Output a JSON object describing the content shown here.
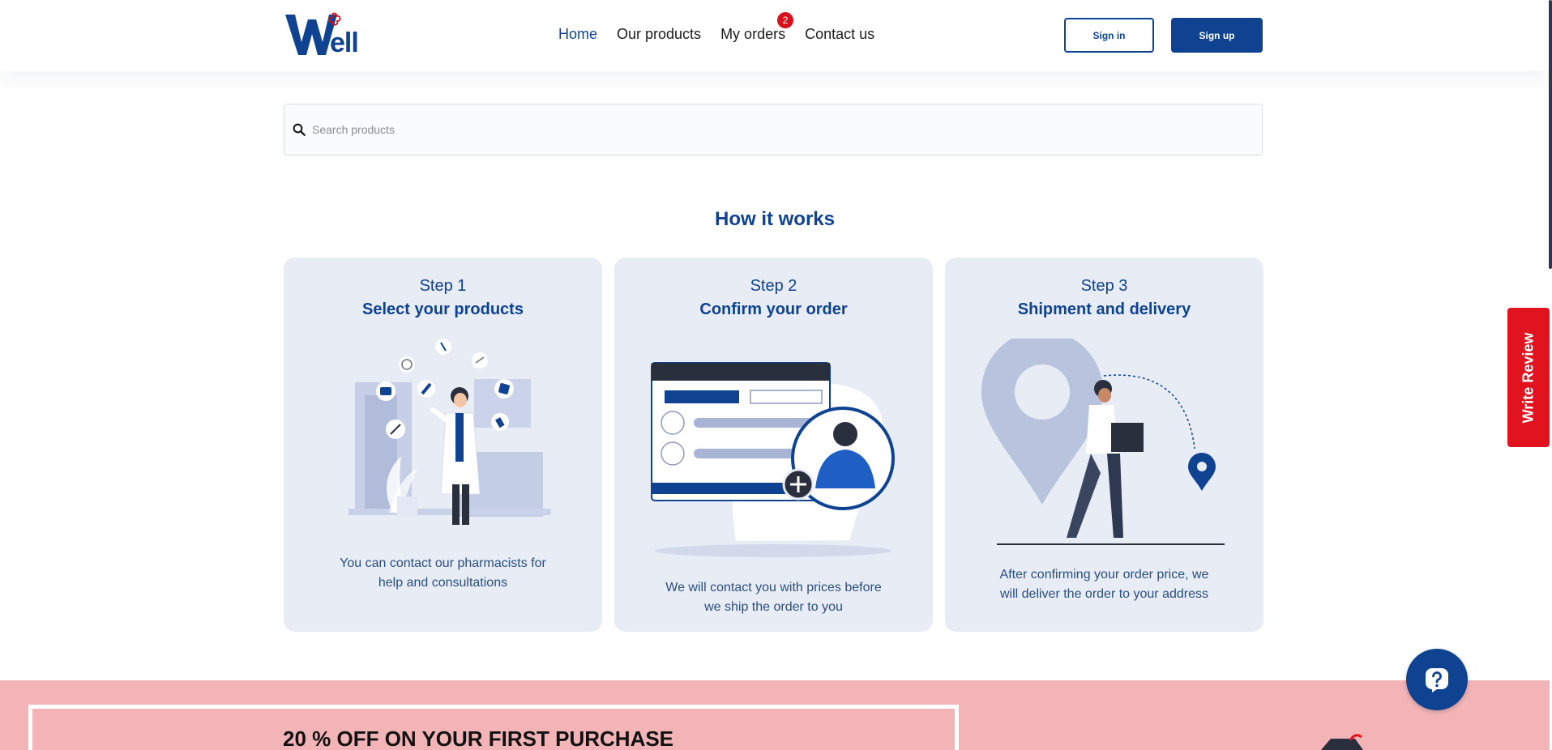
{
  "header": {
    "logo_text": "Well",
    "nav": [
      {
        "label": "Home",
        "active": true
      },
      {
        "label": "Our products",
        "active": false
      },
      {
        "label": "My orders",
        "active": false,
        "badge": "2"
      },
      {
        "label": "Contact us",
        "active": false
      }
    ],
    "signin_label": "Sign in",
    "signup_label": "Sign up"
  },
  "search": {
    "placeholder": "Search products"
  },
  "how_it_works": {
    "title": "How it works",
    "steps": [
      {
        "step": "Step 1",
        "title": "Select your products",
        "desc": "You can contact our pharmacists for help and consultations"
      },
      {
        "step": "Step 2",
        "title": "Confirm your order",
        "desc": "We will contact you with prices before we ship the order to you"
      },
      {
        "step": "Step 3",
        "title": "Shipment and delivery",
        "desc": "After confirming your order price, we will deliver the order to your address"
      }
    ]
  },
  "write_review_label": "Write Review",
  "promo": {
    "text": "20 % OFF ON YOUR FIRST PURCHASE"
  },
  "colors": {
    "brand": "#0f4391",
    "accent": "#e1131f",
    "card_bg": "#e7ecf5",
    "promo_bg": "#f3b4b7"
  },
  "icons": [
    "search-icon",
    "question-icon",
    "logo-icon"
  ]
}
